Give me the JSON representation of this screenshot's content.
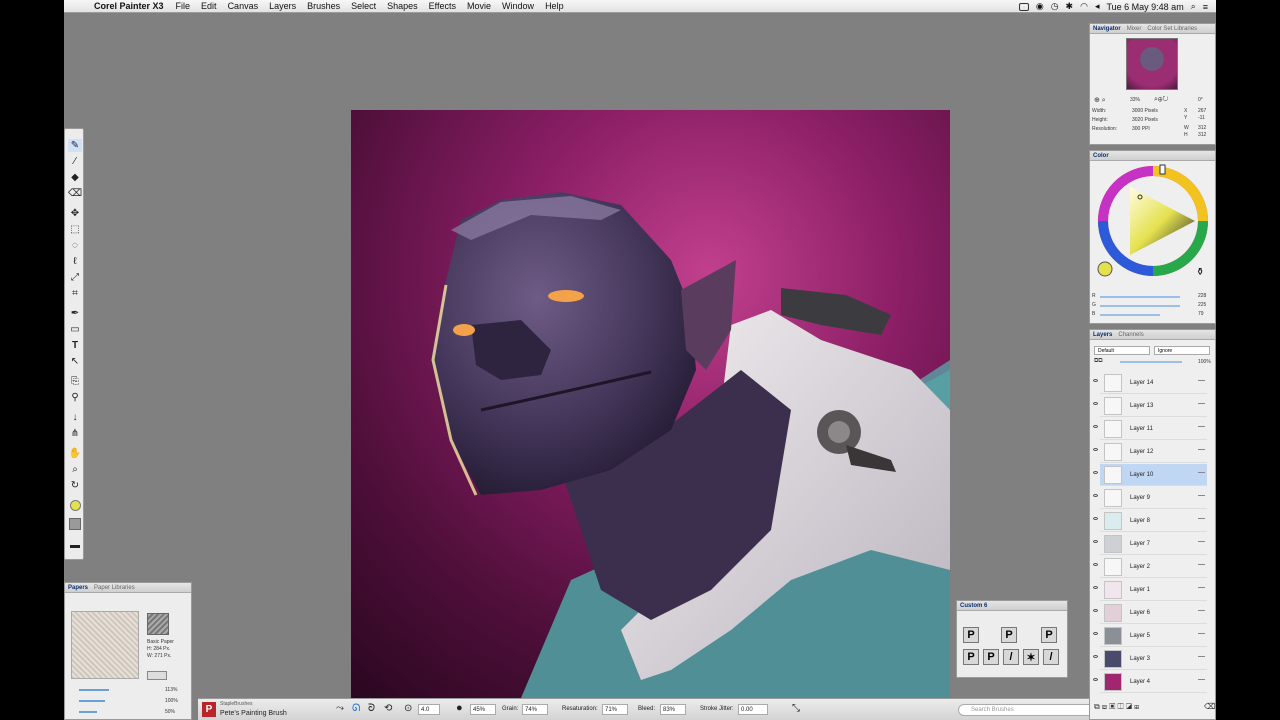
{
  "menubar": {
    "app_name": "Corel Painter X3",
    "menus": [
      "File",
      "Edit",
      "Canvas",
      "Layers",
      "Brushes",
      "Select",
      "Shapes",
      "Effects",
      "Movie",
      "Window",
      "Help"
    ],
    "clock": "Tue 6 May  9:48 am"
  },
  "navigator": {
    "tabs": [
      "Navigator",
      "Mixer",
      "Color Set Libraries"
    ],
    "zoom": "33%",
    "angle": "0°",
    "width_label": "Width:",
    "width_value": "3000 Pixels",
    "height_label": "Height:",
    "height_value": "3020 Pixels",
    "resolution_label": "Resolution:",
    "resolution_value": "300 PPI",
    "x_label": "X",
    "x_value": "267",
    "y_label": "Y",
    "y_value": "-11",
    "w_label": "W",
    "w_value": "312",
    "h_label": "H",
    "h_value": "312"
  },
  "color": {
    "title": "Color",
    "r_label": "R",
    "r_value": "228",
    "g_label": "G",
    "g_value": "225",
    "b_label": "B",
    "b_value": "79",
    "current_color": "#e4e14f"
  },
  "layers": {
    "tabs": [
      "Layers",
      "Channels"
    ],
    "composite_method": "Default",
    "depth_mode": "Ignore",
    "opacity": "100%",
    "items": [
      {
        "name": "Layer 14",
        "selected": false
      },
      {
        "name": "Layer 13",
        "selected": false
      },
      {
        "name": "Layer 11",
        "selected": false
      },
      {
        "name": "Layer 12",
        "selected": false
      },
      {
        "name": "Layer 10",
        "selected": true
      },
      {
        "name": "Layer 9",
        "selected": false
      },
      {
        "name": "Layer 8",
        "selected": false
      },
      {
        "name": "Layer 7",
        "selected": false
      },
      {
        "name": "Layer 2",
        "selected": false
      },
      {
        "name": "Layer 1",
        "selected": false
      },
      {
        "name": "Layer 6",
        "selected": false
      },
      {
        "name": "Layer 5",
        "selected": false
      },
      {
        "name": "Layer 3",
        "selected": false
      },
      {
        "name": "Layer 4",
        "selected": false
      }
    ]
  },
  "papers": {
    "tabs": [
      "Papers",
      "Paper Libraries"
    ],
    "paper_name": "Basic Paper",
    "paper_h": "H: 284 Px.",
    "paper_w": "W: 271 Px.",
    "scale_value": "113%",
    "contrast_value": "100%",
    "brightness_value": "50%"
  },
  "custom_palette": {
    "title": "Custom 6"
  },
  "propbar": {
    "brush_category": "StapleBrushes",
    "brush_variant": "Pete's Painting Brush",
    "size_value": "4.0",
    "opacity_value": "45%",
    "grain_label": "Grain:",
    "grain_value": "74%",
    "resat_label": "Resaturation:",
    "resat_value": "71%",
    "bleed_label": "Bleed:",
    "bleed_value": "83%",
    "jitter_label": "Stroke Jitter:",
    "jitter_value": "0.00",
    "search_placeholder": "Search Brushes"
  }
}
